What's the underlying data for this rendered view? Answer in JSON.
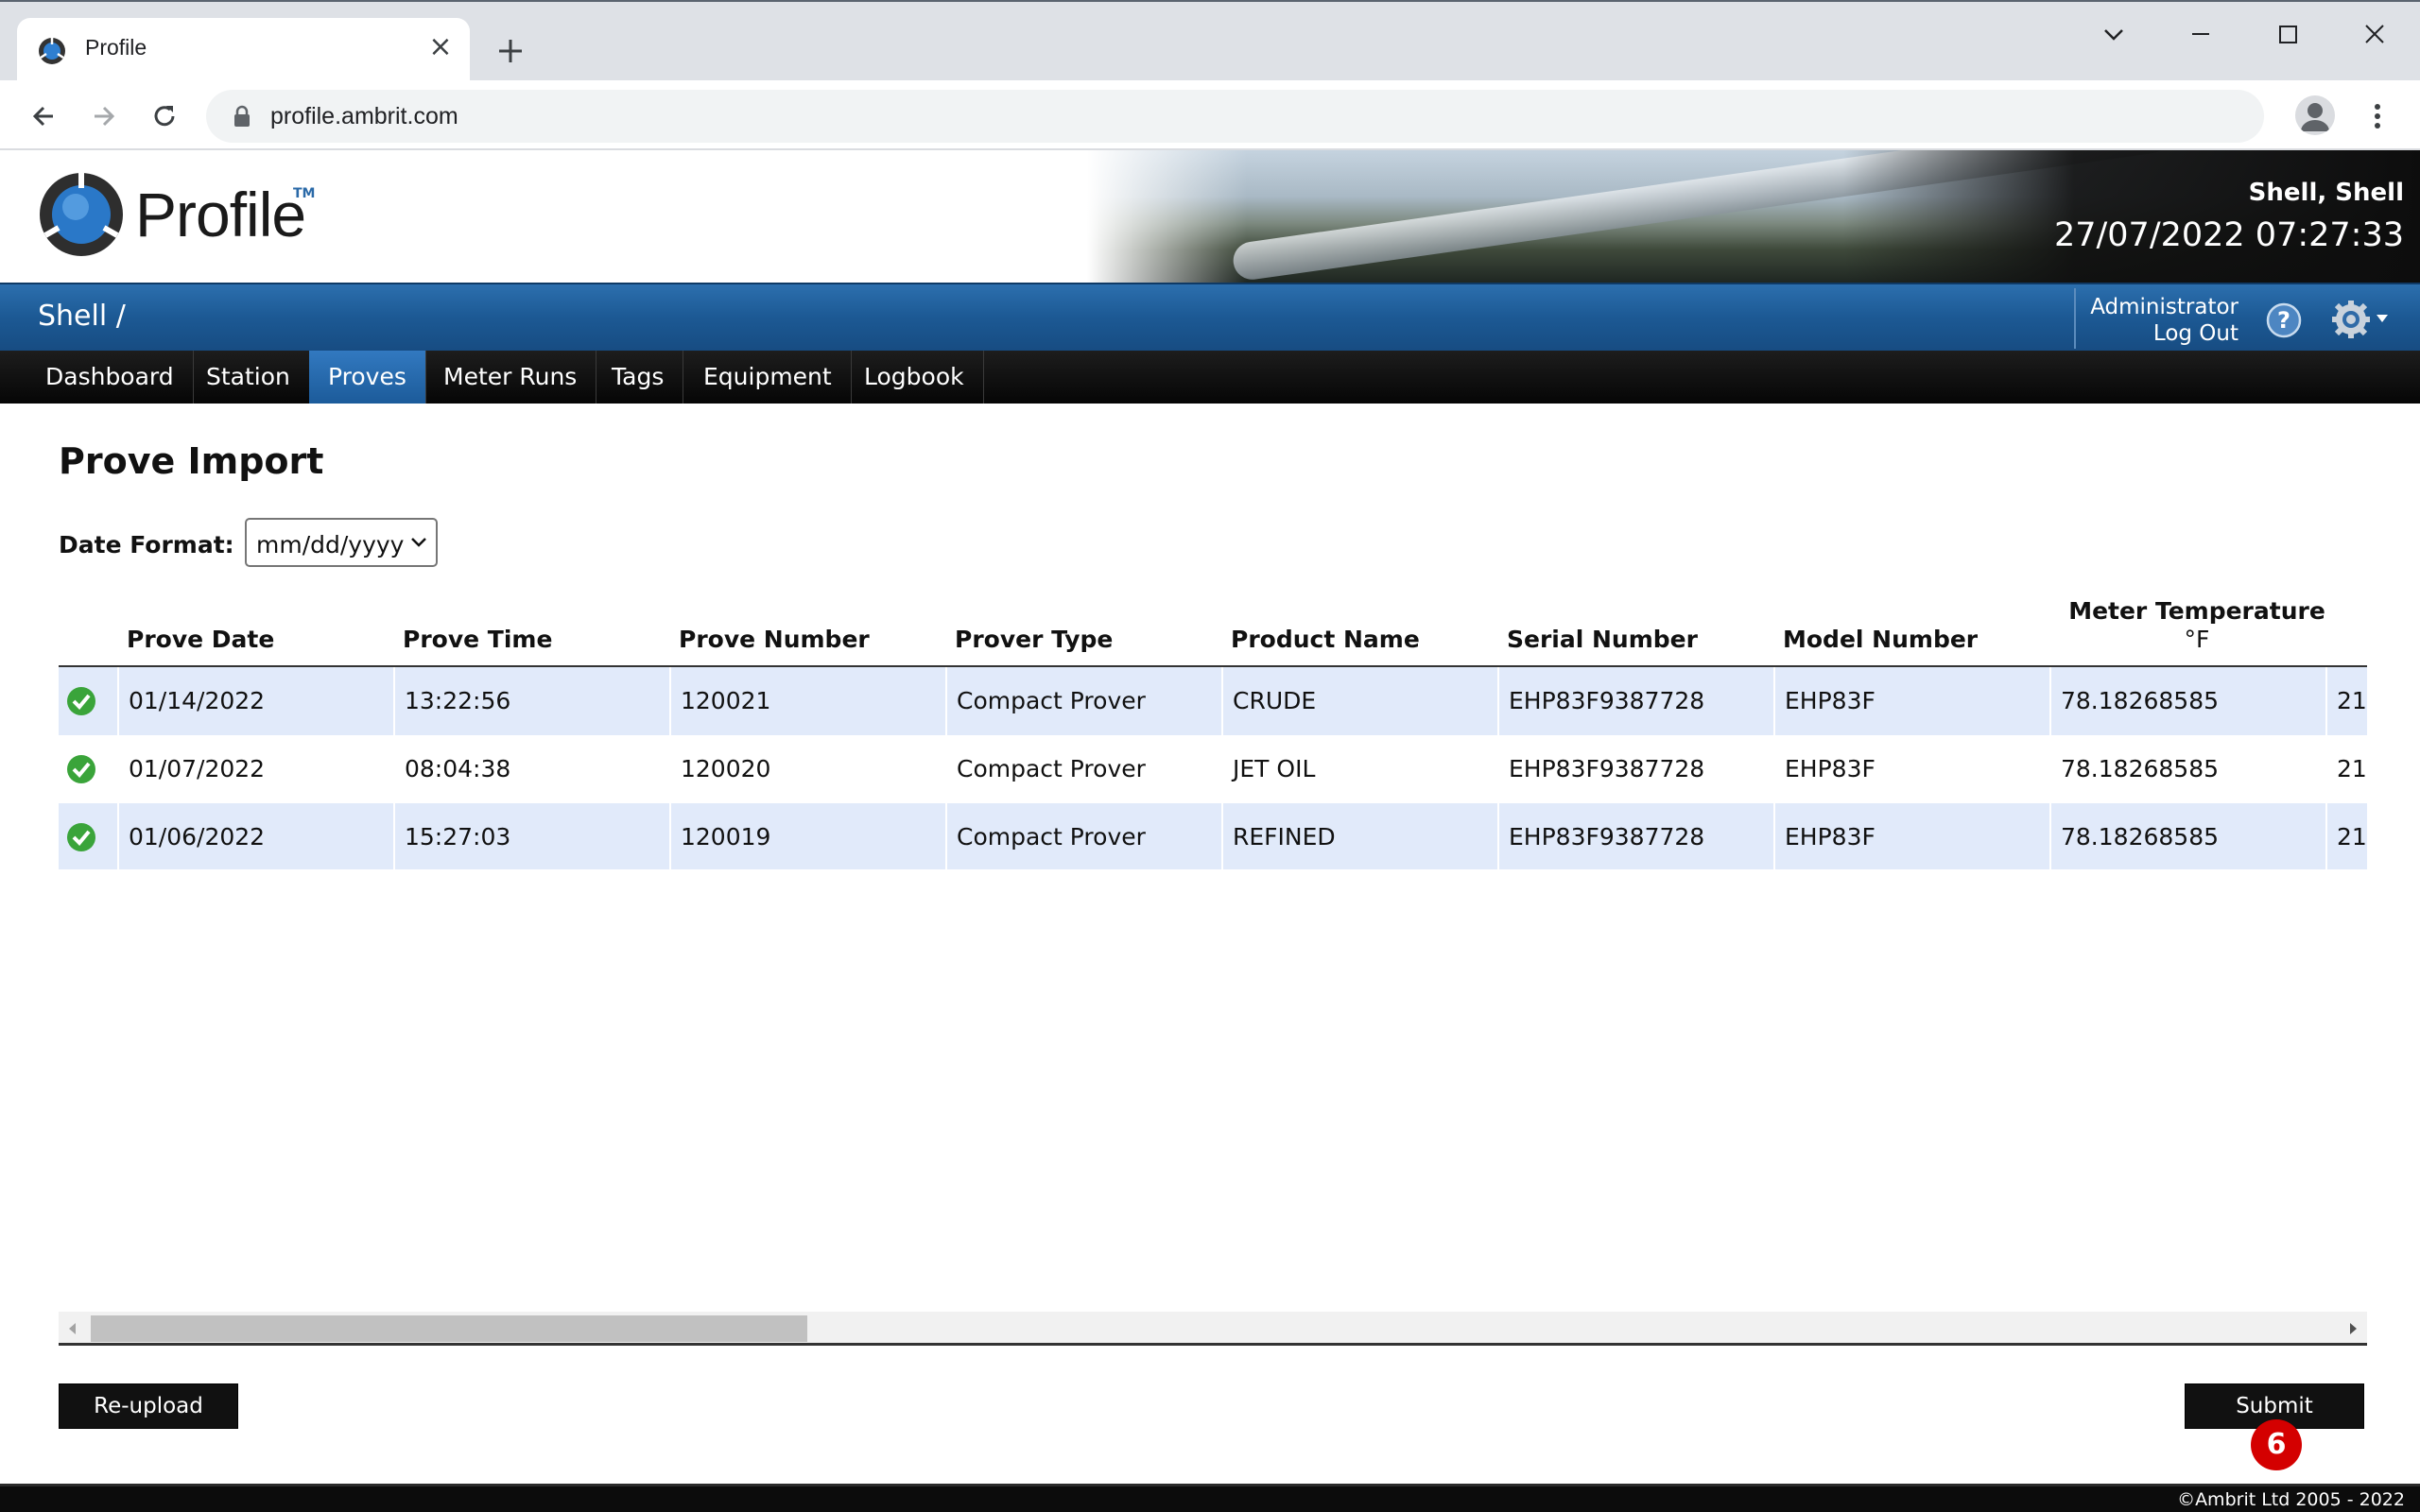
{
  "browser": {
    "tab_title": "Profile",
    "url": "profile.ambrit.com"
  },
  "header": {
    "logo_text": "Profile",
    "logo_tm": "TM",
    "user_name": "Shell, Shell",
    "datetime": "27/07/2022 07:27:33"
  },
  "bluebar": {
    "breadcrumb": "Shell /",
    "role": "Administrator",
    "logout": "Log Out"
  },
  "nav": {
    "items": [
      "Dashboard",
      "Station",
      "Proves",
      "Meter Runs",
      "Tags",
      "Equipment",
      "Logbook"
    ],
    "active": "Proves"
  },
  "page": {
    "title": "Prove Import",
    "date_format_label": "Date Format:",
    "date_format_value": "mm/dd/yyyy"
  },
  "table": {
    "headers": [
      "Prove Date",
      "Prove Time",
      "Prove Number",
      "Prover Type",
      "Product Name",
      "Serial Number",
      "Model Number",
      "Meter Temperature"
    ],
    "temp_unit": "°F",
    "rows": [
      {
        "status": "valid",
        "date": "01/14/2022",
        "time": "13:22:56",
        "number": "120021",
        "prover": "Compact Prover",
        "product": "CRUDE",
        "serial": "EHP83F9387728",
        "model": "EHP83F",
        "temp": "78.18268585",
        "next": "21"
      },
      {
        "status": "valid",
        "date": "01/07/2022",
        "time": "08:04:38",
        "number": "120020",
        "prover": "Compact Prover",
        "product": "JET OIL",
        "serial": "EHP83F9387728",
        "model": "EHP83F",
        "temp": "78.18268585",
        "next": "21"
      },
      {
        "status": "valid",
        "date": "01/06/2022",
        "time": "15:27:03",
        "number": "120019",
        "prover": "Compact Prover",
        "product": "REFINED",
        "serial": "EHP83F9387728",
        "model": "EHP83F",
        "temp": "78.18268585",
        "next": "21"
      }
    ]
  },
  "actions": {
    "reupload": "Re-upload",
    "submit": "Submit",
    "badge": "6"
  },
  "footer": {
    "copyright": "©Ambrit Ltd 2005 - 2022"
  },
  "colors": {
    "blue_bar": "#1c5994",
    "active_tab": "#2a6db2",
    "row_alt": "#e1eafa",
    "check": "#3aa43a",
    "badge": "#d40000"
  }
}
